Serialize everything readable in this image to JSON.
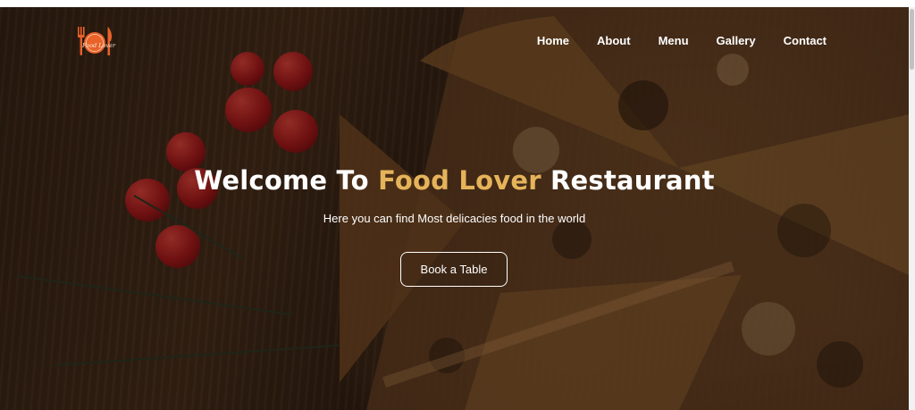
{
  "brand": {
    "logo_text": "Food Lover",
    "accent_color": "#e5b35a",
    "logo_color": "#e8622a"
  },
  "nav": {
    "items": [
      {
        "label": "Home"
      },
      {
        "label": "About"
      },
      {
        "label": "Menu"
      },
      {
        "label": "Gallery"
      },
      {
        "label": "Contact"
      }
    ]
  },
  "hero": {
    "title_prefix": "Welcome To ",
    "title_accent": "Food Lover",
    "title_suffix": " Restaurant",
    "subtitle": "Here you can find Most delicacies food in the world",
    "cta_label": "Book a Table"
  },
  "icons": {
    "logo": "fork-plate-knife-logo-icon"
  }
}
